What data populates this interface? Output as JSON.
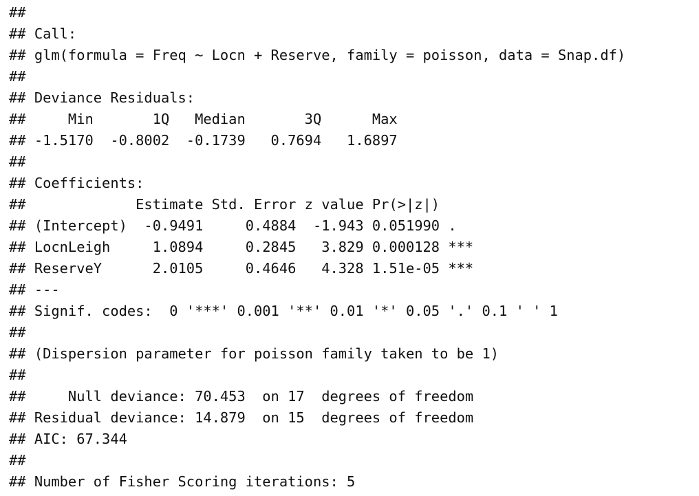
{
  "output_lines": [
    "##",
    "## Call:",
    "## glm(formula = Freq ~ Locn + Reserve, family = poisson, data = Snap.df)",
    "##",
    "## Deviance Residuals:",
    "##     Min       1Q   Median       3Q      Max",
    "## -1.5170  -0.8002  -0.1739   0.7694   1.6897",
    "##",
    "## Coefficients:",
    "##             Estimate Std. Error z value Pr(>|z|)",
    "## (Intercept)  -0.9491     0.4884  -1.943 0.051990 .",
    "## LocnLeigh     1.0894     0.2845   3.829 0.000128 ***",
    "## ReserveY      2.0105     0.4646   4.328 1.51e-05 ***",
    "## ---",
    "## Signif. codes:  0 '***' 0.001 '**' 0.01 '*' 0.05 '.' 0.1 ' ' 1",
    "##",
    "## (Dispersion parameter for poisson family taken to be 1)",
    "##",
    "##     Null deviance: 70.453  on 17  degrees of freedom",
    "## Residual deviance: 14.879  on 15  degrees of freedom",
    "## AIC: 67.344",
    "##",
    "## Number of Fisher Scoring iterations: 5"
  ]
}
